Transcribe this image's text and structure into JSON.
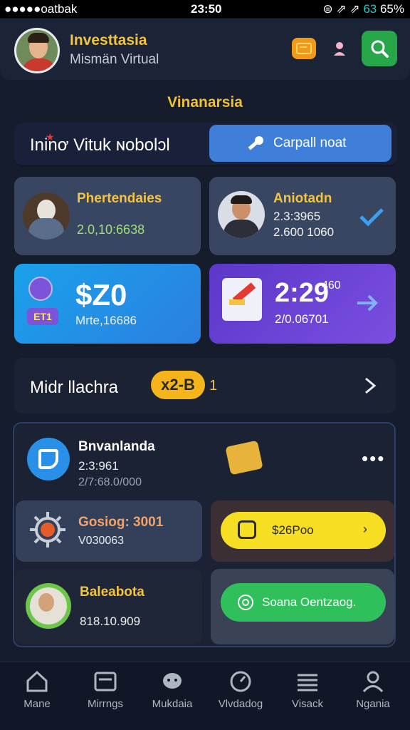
{
  "status_bar": {
    "carrier": "●●●●●oatbak",
    "time": "23:50",
    "icons": "⊜ ⇗ ⇗",
    "signal": "63",
    "battery": "65%"
  },
  "header": {
    "title": "Investtasia",
    "subtitle": "Mismän Virtual"
  },
  "section_title": "Vinanarsia",
  "promo_bar": {
    "text": "Ininơ Vituk ɴobolɔl",
    "button_label": "Carpall noat"
  },
  "cards": [
    {
      "title": "Phertendaies",
      "value": "2.0,10:6638"
    },
    {
      "title": "Aniotadn",
      "line1": "2.3:3965",
      "line2": "2.600 1060"
    },
    {
      "badge": "ET1",
      "big": "$Z0",
      "sub": "Mrte,16686"
    },
    {
      "big": "2:29",
      "small": "460",
      "sub": "2/0.06701"
    }
  ],
  "mid_row": {
    "label": "Midr llachra",
    "badge": "x2-B",
    "count": "1"
  },
  "panel": {
    "title": "Bnvanlanda",
    "line1": "2:3:961",
    "line2": "2/7:68.0/000",
    "gosiog": {
      "title": "Gosiog: 3001",
      "value": "V030063"
    },
    "yellow_btn": "$26Poo",
    "profile": {
      "title": "Baleabota",
      "value": "818.10.909"
    },
    "green_btn": "Soana Oentzaog."
  },
  "nav": [
    "Mane",
    "Mirrngs",
    "Mukdaia",
    "Vlvdadog",
    "Visack",
    "Ngania"
  ],
  "colors": {
    "accent": "#f4c341",
    "primary": "#3f7fd9",
    "success": "#2fc05b",
    "background": "#151c2b"
  }
}
